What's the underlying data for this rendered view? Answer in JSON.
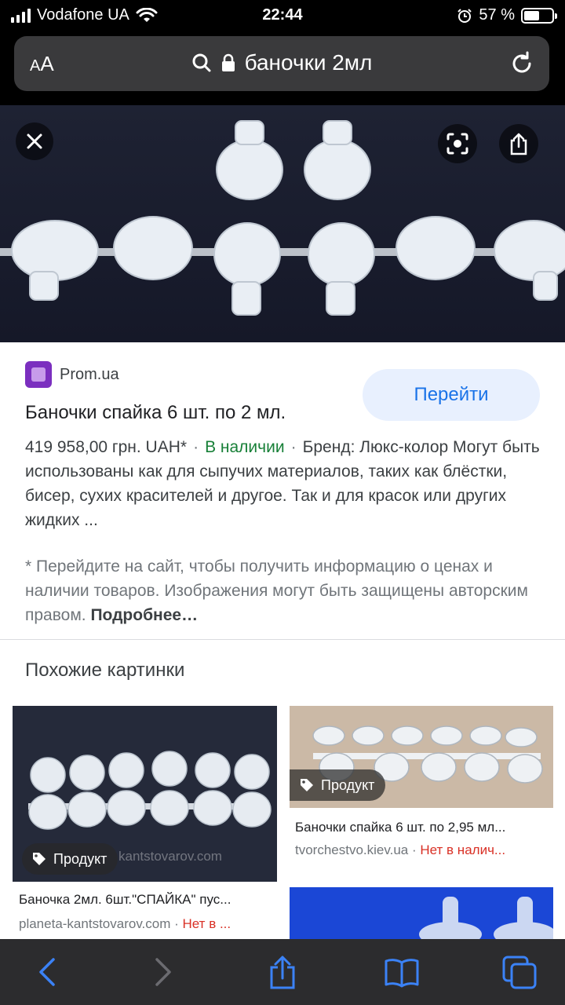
{
  "status": {
    "carrier": "Vodafone UA",
    "time": "22:44",
    "battery_text": "57 %",
    "battery_level": 0.57,
    "icons": [
      "signal-icon",
      "wifi-icon",
      "alarm-icon",
      "battery-icon"
    ]
  },
  "urlbar": {
    "text_size_label": "AA",
    "query": "баночки 2мл",
    "icons": [
      "search-icon",
      "lock-icon",
      "reload-icon"
    ]
  },
  "hero": {
    "icons": [
      "close-icon",
      "lens-icon",
      "share-icon"
    ]
  },
  "result": {
    "site": "Prom.ua",
    "goto_label": "Перейти",
    "title": "Баночки спайка 6 шт. по 2 мл.",
    "price": "419 958,00 грн. UAH*",
    "availability": "В наличии",
    "brand": "Бренд: Люкс-колор",
    "description": "Могут быть использованы как для сыпучих материалов, таких как блёстки, бисер, сухих красителей и другое. Так и для красок или других жидких ...",
    "note": "* Перейдите на сайт, чтобы получить информацию о ценах и наличии товаров. Изображения могут быть защищены авторским правом.",
    "note_more": "Подробнее…"
  },
  "similar": {
    "heading": "Похожие картинки",
    "items": [
      {
        "badge": "Продукт",
        "watermark": "kantstovarov.com",
        "title": "Баночка 2мл. 6шт.\"СПАЙКА\" пус...",
        "source": "planeta-kantstovarov.com",
        "status": "Нет в ..."
      },
      {
        "badge": "Продукт",
        "title": "Баночки спайка 6 шт. по 2,95 мл...",
        "source": "tvorchestvo.kiev.ua",
        "status": "Нет в налич..."
      }
    ]
  },
  "toolbar": {
    "icons": [
      "back-icon",
      "forward-icon",
      "share-icon",
      "bookmarks-icon",
      "tabs-icon"
    ]
  },
  "colors": {
    "link_blue": "#1a73e8",
    "in_stock_green": "#188038",
    "out_of_stock_red": "#d93025",
    "toolbar_bg": "#2c2c2e"
  }
}
